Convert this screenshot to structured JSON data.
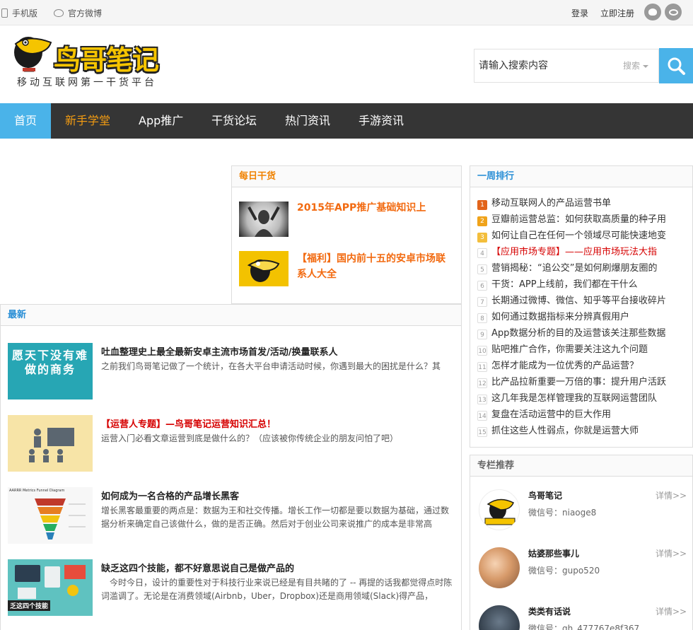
{
  "topbar": {
    "mobile": "手机版",
    "weibo": "官方微博",
    "login": "登录",
    "register": "立即注册"
  },
  "logo": {
    "text": "鸟哥笔记",
    "slogan": "移动互联网第一干货平台"
  },
  "search": {
    "placeholder": "请输入搜索内容",
    "type_label": "搜索"
  },
  "nav": {
    "items": [
      "首页",
      "新手学堂",
      "App推广",
      "干货论坛",
      "热门资讯",
      "手游资讯"
    ]
  },
  "daily": {
    "title": "每日干货",
    "items": [
      {
        "title": "2015年APP推广基础知识上"
      },
      {
        "title": "【福利】国内前十五的安卓市场联系人大全"
      }
    ]
  },
  "latest": {
    "title": "最新",
    "items": [
      {
        "title": "吐血整理史上最全最新安卓主流市场首发/活动/换量联系人",
        "desc": "之前我们鸟哥笔记做了一个统计，在各大平台申请活动时候，你遇到最大的困扰是什么？其",
        "thumb_text": "愿天下没有难做的商务"
      },
      {
        "title": "【运营人专题】—鸟哥笔记运营知识汇总！",
        "desc": "运营入门必看文章运营到底是做什么的？（应该被你传统企业的朋友问怕了吧）"
      },
      {
        "title": "如何成为一名合格的产品增长黑客",
        "desc": "增长黑客最重要的两点是：数据为王和社交传播。增长工作一切都是要以数据为基础，通过数据分析来确定自己该做什么，做的是否正确。然后对于创业公司来说推广的成本是非常高",
        "thumb_text": "AARRR Metrics Funnel Diagram"
      },
      {
        "title": "缺乏这四个技能，都不好意思说自己是做产品的",
        "desc": "　今时今日，设计的重要性对于科技行业来说已经是有目共睹的了 -- 再提的话我都觉得点时陈词滥调了。无论是在消费领域(Airbnb，Uber，Dropbox)还是商用领域(Slack)得产品，",
        "thumb_text": "乏这四个技能"
      }
    ]
  },
  "ranking": {
    "title": "一周排行",
    "items": [
      {
        "num": "1",
        "title": "移动互联网人的产品运营书单"
      },
      {
        "num": "2",
        "title": "豆瓣前运营总监：如何获取高质量的种子用"
      },
      {
        "num": "3",
        "title": "如何让自己在任何一个领域尽可能快速地变"
      },
      {
        "num": "4",
        "title": "【应用市场专题】——应用市场玩法大指"
      },
      {
        "num": "5",
        "title": "营销揭秘：“追公交”是如何刷爆朋友圈的"
      },
      {
        "num": "6",
        "title": "干货：APP上线前，我们都在干什么"
      },
      {
        "num": "7",
        "title": "长期通过微博、微信、知乎等平台接收碎片"
      },
      {
        "num": "8",
        "title": "如何通过数据指标来分辨真假用户"
      },
      {
        "num": "9",
        "title": "App数据分析的目的及运营该关注那些数据"
      },
      {
        "num": "10",
        "title": "贴吧推广合作，你需要关注这九个问题"
      },
      {
        "num": "11",
        "title": "怎样才能成为一位优秀的产品运营？"
      },
      {
        "num": "12",
        "title": "比产品拉新重要一万倍的事：提升用户活跃"
      },
      {
        "num": "13",
        "title": "这几年我是怎样管理我的互联网运营团队"
      },
      {
        "num": "14",
        "title": "复盘在活动运营中的巨大作用"
      },
      {
        "num": "15",
        "title": "抓住这些人性弱点，你就是运营大师"
      }
    ],
    "colors": {
      "top1": "#e2641b",
      "top2": "#f0a31a",
      "top3": "#f3be3c"
    }
  },
  "columns": {
    "title": "专栏推荐",
    "more_label": "详情>>",
    "items": [
      {
        "name": "鸟哥笔记",
        "wechat": "微信号：niaoge8"
      },
      {
        "name": "姑婆那些事儿",
        "wechat": "微信号：gupo520"
      },
      {
        "name": "类类有话说",
        "wechat": "微信号：gh_477767e8f367"
      }
    ]
  },
  "colors": {
    "accent_blue": "#4ab3e9",
    "nav_bg": "#353535",
    "nav_highlight": "#f39c12",
    "title_orange": "#f08200",
    "link_blue": "#2a8fd6",
    "red": "#d60000"
  }
}
